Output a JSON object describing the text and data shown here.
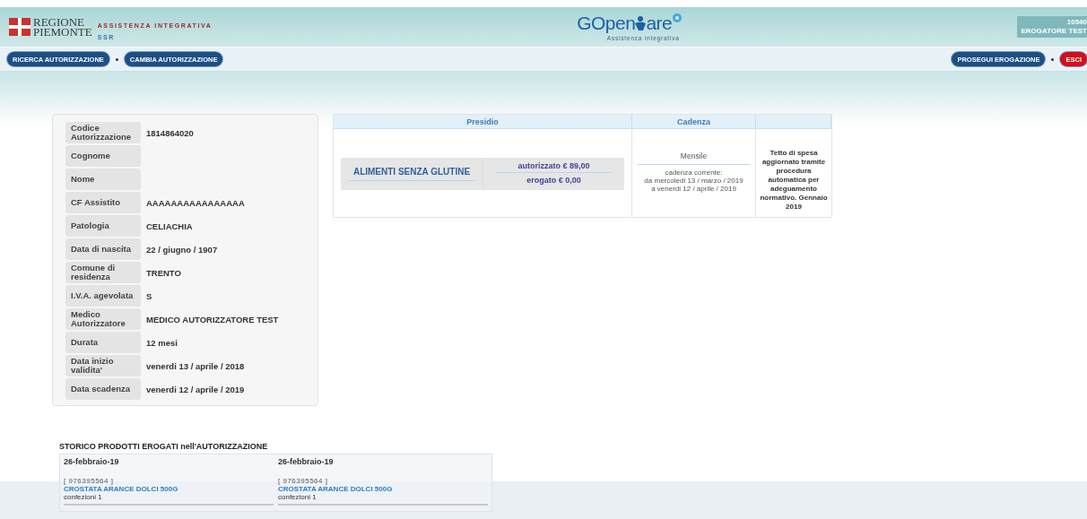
{
  "header": {
    "region_logo": {
      "line1": "REGIONE",
      "line2": "PIEMONTE"
    },
    "app_title": "ASSISTENZA INTEGRATIVA",
    "app_subtitle": "SSR",
    "brand": {
      "pre": "GOpen",
      "post": "are",
      "tagline": "Assistenza integrativa"
    },
    "user": {
      "code": "10540",
      "name": "EROGATORE TEST"
    }
  },
  "nav": {
    "left": [
      {
        "label": "RICERCA AUTORIZZAZIONE",
        "kind": "primary"
      },
      {
        "label": "CAMBIA AUTORIZZAZIONE",
        "kind": "primary"
      }
    ],
    "right": [
      {
        "label": "PROSEGUI EROGAZIONE",
        "kind": "primary"
      },
      {
        "label": "ESCI",
        "kind": "danger"
      }
    ]
  },
  "details": [
    {
      "label": "Codice Autorizzazione",
      "value": "1814864020"
    },
    {
      "label": "Cognome"
    },
    {
      "label": "Nome"
    },
    {
      "label": "CF Assistito",
      "value": "AAAAAAAAAAAAAAAA"
    },
    {
      "label": "Patologia",
      "value": "CELIACHIA"
    },
    {
      "label": "Data di nascita",
      "value": "22 / giugno / 1907"
    },
    {
      "label": "Comune di residenza",
      "value": "TRENTO"
    },
    {
      "label": "I.V.A. agevolata",
      "value": "S"
    },
    {
      "label": "Medico Autorizzatore",
      "value": "MEDICO AUTORIZZATORE TEST"
    },
    {
      "label": "Durata",
      "value": "12 mesi"
    },
    {
      "label": "Data inizio validita'",
      "value": "venerdi 13 / aprile / 2018"
    },
    {
      "label": "Data scadenza",
      "value": "venerdi 12 / aprile / 2019"
    }
  ],
  "presidio_table": {
    "columns": [
      "Presidio",
      "Cadenza"
    ],
    "row": {
      "product": "ALIMENTI SENZA GLUTINE",
      "authorized": "autorizzato € 89,00",
      "dispensed": "erogato € 0,00",
      "frequency": "Mensile",
      "current_label": "cadenza corrente:",
      "period": [
        "da mercoledi 13 / marzo / 2019",
        "a venerdi 12 / aprile / 2019"
      ],
      "note": "Tetto di spesa aggiornato tramite procedura automatica per adeguamento normativo. Gennaio 2019"
    }
  },
  "history": {
    "title": "STORICO PRODOTTI EROGATI nell'AUTORIZZAZIONE",
    "items": [
      {
        "date": "26-febbraio-19",
        "code": "[ 976395564 ]",
        "product": "CROSTATA ARANCE DOLCI 500G",
        "quantity": "confezioni 1"
      },
      {
        "date": "26-febbraio-19",
        "code": "[ 976395564 ]",
        "product": "CROSTATA ARANCE DOLCI 500G",
        "quantity": "confezioni 1"
      }
    ]
  }
}
